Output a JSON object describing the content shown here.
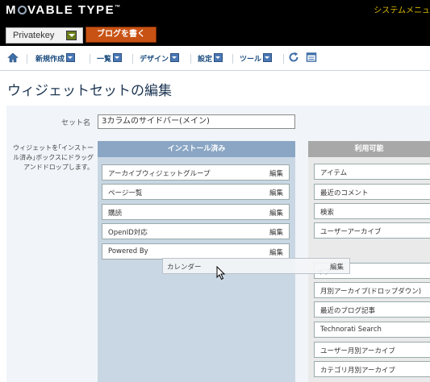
{
  "app": {
    "logo_prefix": "M",
    "logo_suffix": "VABLE TYPE",
    "logo_tm": "™",
    "system_menu": "システムメニュ"
  },
  "blog_selector": {
    "value": "Privatekey"
  },
  "write_button": "ブログを書く",
  "nav": {
    "items": [
      {
        "label": "新規作成"
      },
      {
        "label": "一覧"
      },
      {
        "label": "デザイン"
      },
      {
        "label": "設定"
      },
      {
        "label": "ツール"
      }
    ]
  },
  "page": {
    "title": "ウィジェットセットの編集"
  },
  "form": {
    "set_name_label": "セット名",
    "set_name_value": "3カラムのサイドバー(メイン)"
  },
  "help_text": "ウィジェットを｢インストール済み｣ボックスにドラッグアンドドロップします。",
  "installed": {
    "header": "インストール済み",
    "edit_label": "編集",
    "widgets": [
      {
        "label": "アーカイブウィジェットグループ"
      },
      {
        "label": "ページ一覧"
      },
      {
        "label": "購読"
      },
      {
        "label": "OpenID対応"
      },
      {
        "label": "Powered By"
      }
    ]
  },
  "available": {
    "header": "利用可能",
    "widgets": [
      {
        "label": "アイテム"
      },
      {
        "label": "最近のコメント"
      },
      {
        "label": "検索"
      },
      {
        "label": "ユーザーアーカイブ"
      },
      {
        "label": "イブ"
      },
      {
        "label": "月別アーカイブ(ドロップダウン)"
      },
      {
        "label": "最近のブログ記事"
      },
      {
        "label": "Technorati Search"
      },
      {
        "label": "ユーザー月別アーカイブ"
      },
      {
        "label": "カテゴリ月別アーカイブ"
      }
    ]
  },
  "dragging_widget": {
    "label": "カレンダー",
    "edit": "編集"
  },
  "colors": {
    "topbar": "#000000",
    "accent": "#c85214",
    "installed_header": "#8aa6c4",
    "available_header": "#a8a8a8"
  },
  "icons": [
    "home-icon",
    "chevron-down-icon",
    "refresh-icon",
    "view-site-icon",
    "cursor-icon"
  ]
}
